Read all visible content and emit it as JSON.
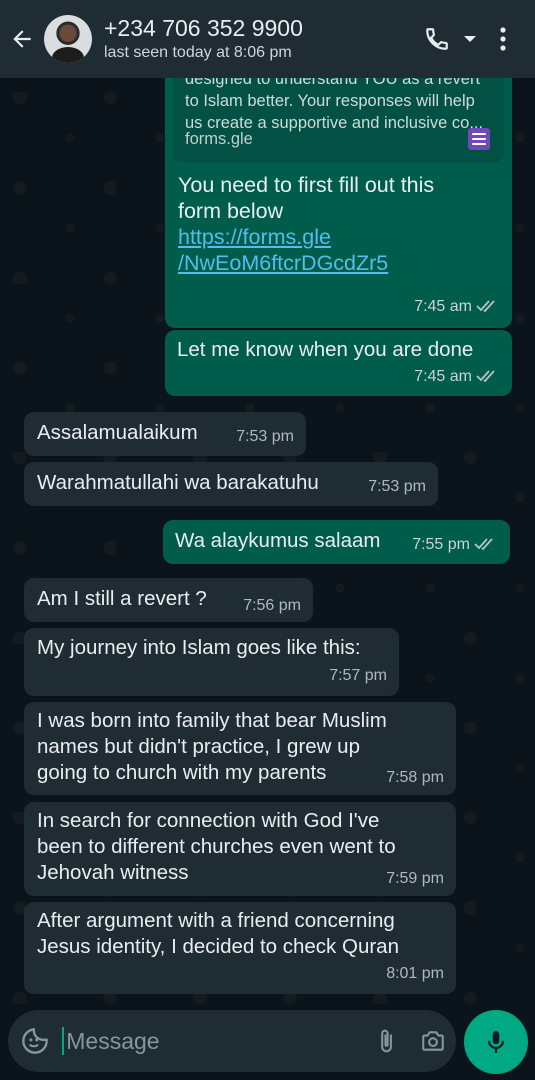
{
  "header": {
    "contact_name": "+234 706 352 9900",
    "status": "last seen today at 8:06 pm"
  },
  "colors": {
    "header_bg": "#1f2c34",
    "chat_bg": "#0b141a",
    "outgoing_bubble": "#005c4b",
    "incoming_bubble": "#202c33",
    "accent": "#00a884",
    "link": "#53bdeb"
  },
  "icons": {
    "back": "back-arrow-icon",
    "call": "phone-icon",
    "call_menu": "dropdown-caret-icon",
    "more": "more-vertical-icon",
    "emoji": "sticker-icon",
    "attach": "paperclip-icon",
    "camera": "camera-icon",
    "mic": "microphone-icon",
    "form": "google-forms-icon",
    "read": "double-check-icon"
  },
  "messages": [
    {
      "direction": "out",
      "preview_desc": [
        "designed to understand YOU as a revert",
        "to Islam better. Your responses will help",
        "us create a supportive and inclusive co..."
      ],
      "preview_site": "forms.gle",
      "lines": [
        "You need to first fill out this",
        "form below"
      ],
      "link_lines": [
        "https://forms.gle",
        "/NwEoM6ftcrDGcdZr5"
      ],
      "time": "7:45 am",
      "read": true
    },
    {
      "direction": "out",
      "text": "Let me know when you are done",
      "time": "7:45 am",
      "read": true
    },
    {
      "direction": "in",
      "text": "Assalamualaikum",
      "time": "7:53 pm"
    },
    {
      "direction": "in",
      "text": "Warahmatullahi wa barakatuhu",
      "time": "7:53 pm"
    },
    {
      "direction": "out",
      "text": "Wa alaykumus salaam",
      "time": "7:55 pm",
      "read": true
    },
    {
      "direction": "in",
      "text": "Am I still a revert ?",
      "time": "7:56 pm"
    },
    {
      "direction": "in",
      "text": "My journey into Islam goes like this:",
      "time": "7:57 pm"
    },
    {
      "direction": "in",
      "lines": [
        "I was born into family that bear Muslim",
        "names but didn't practice, I grew up",
        "going to church with my parents"
      ],
      "time": "7:58 pm"
    },
    {
      "direction": "in",
      "lines": [
        "In search for connection with God I've",
        "been to different churches even went to",
        "Jehovah witness"
      ],
      "time": "7:59 pm"
    },
    {
      "direction": "in",
      "lines": [
        "After argument with a friend concerning",
        "Jesus identity, I decided to check Quran"
      ],
      "time": "8:01 pm"
    }
  ],
  "composer": {
    "placeholder": "Message"
  }
}
